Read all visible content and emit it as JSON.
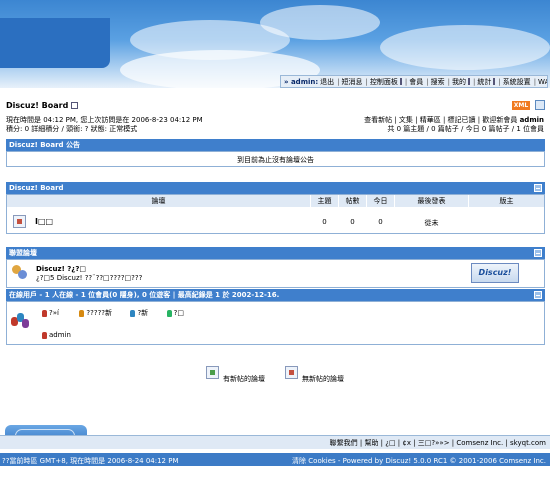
{
  "nav": {
    "greeting": "» admin:",
    "items": [
      "退出",
      "短消息",
      "控制面板",
      "會員",
      "搜索",
      "我的",
      "統計",
      "系統設置",
      "WAP"
    ]
  },
  "board_title": "Discuz! Board",
  "xml_badge": "XML",
  "info": {
    "line1": "現在時間是 04:12 PM, 您上次訪問是在 2006-8-23 04:12 PM",
    "line2": "積分: 0 詳細積分 / 頭銜: ?",
    "line2_status": "狀態: 正常模式",
    "right_line1": "查看新帖 | 文集 | 精華區 | 標記已讀 | 歡迎新會員",
    "right_user": "admin",
    "right_line2": "共 0 篇主題 / 0 篇帖子 / 今日 0 篇帖子 / 1 位會員"
  },
  "announce": {
    "title": "Discuz! Board 公告",
    "text": "到目前為止沒有論壇公告"
  },
  "forum": {
    "title": "Discuz! Board",
    "columns": [
      "論壇",
      "主題",
      "帖數",
      "今日",
      "最後發表",
      "版主"
    ],
    "row": {
      "name": "I□□",
      "topics": "0",
      "posts": "0",
      "today": "0",
      "last": "從未",
      "mod": ""
    }
  },
  "links": {
    "title": "聯盟論壇",
    "name": "Discuz! ?¿?□",
    "desc": "¿?□5 Discuz! ??¨??□????□???",
    "logo": "Discuz!"
  },
  "online": {
    "title": "在線用戶 - 1 人在線 - 1 位會員(0 隱身), 0 位遊客 | 最高紀錄是 1 於 2002-12-16.",
    "legend": [
      {
        "label": "?»í",
        "color": "#c0392b"
      },
      {
        "label": "?????新",
        "color": "#d68910"
      },
      {
        "label": "?新",
        "color": "#2e86c1"
      },
      {
        "label": "?□",
        "color": "#28b463"
      }
    ],
    "user": "admin"
  },
  "legend_bottom": {
    "new": "有新帖的論壇",
    "nonew": "無新帖的論壇"
  },
  "footer": {
    "links": "聯繫我們 | 幫助 | ¿□ | ¢x | 三□?»»> | Comsenz Inc. | skyqt.com",
    "timezone": "??當前時區 GMT+8, 現在時間是 2006-8-24 04:12 PM",
    "powered": "清除 Cookies - Powered by Discuz! 5.0.0 RC1 © 2001-2006 Comsenz Inc."
  }
}
